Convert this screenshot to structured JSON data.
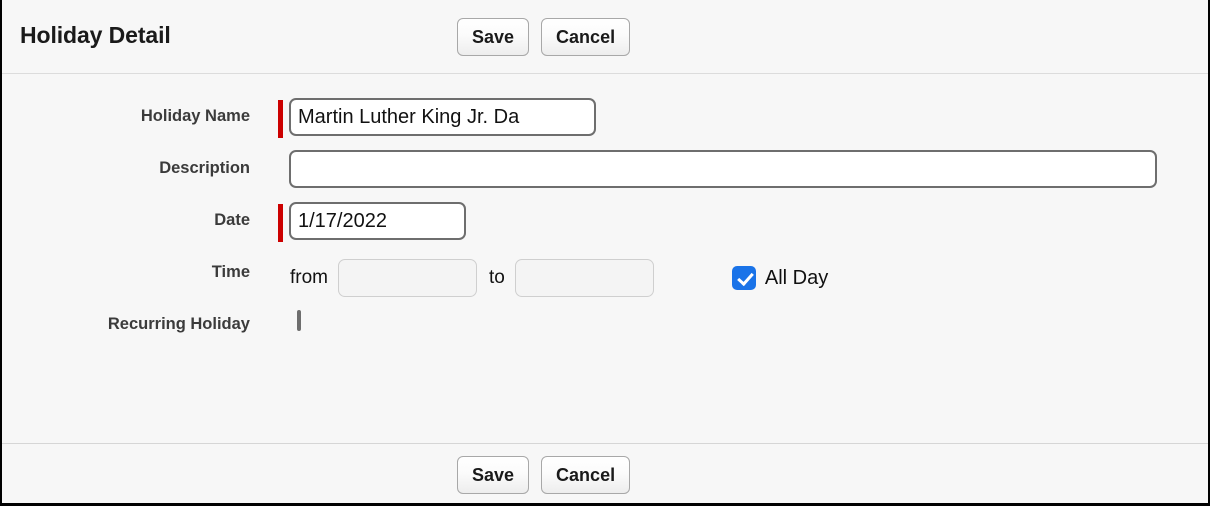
{
  "header": {
    "title": "Holiday Detail",
    "save_label": "Save",
    "cancel_label": "Cancel"
  },
  "form": {
    "holiday_name": {
      "label": "Holiday Name",
      "value": "Martin Luther King Jr. Da",
      "placeholder": "",
      "required": true
    },
    "description": {
      "label": "Description",
      "value": "",
      "placeholder": "",
      "required": false
    },
    "date": {
      "label": "Date",
      "value": "1/17/2022",
      "placeholder": "",
      "required": true
    },
    "time": {
      "label": "Time",
      "from_prefix": "from",
      "from_value": "",
      "to_prefix": "to",
      "to_value": "",
      "all_day_label": "All Day",
      "all_day_checked": "checked"
    },
    "recurring": {
      "label": "Recurring Holiday",
      "checked": ""
    }
  },
  "footer": {
    "save_label": "Save",
    "cancel_label": "Cancel"
  },
  "colors": {
    "required_marker": "#cc0000",
    "checkbox_accent": "#1a73e8",
    "background": "#f7f7f7",
    "label_text": "#3b3b3b"
  }
}
